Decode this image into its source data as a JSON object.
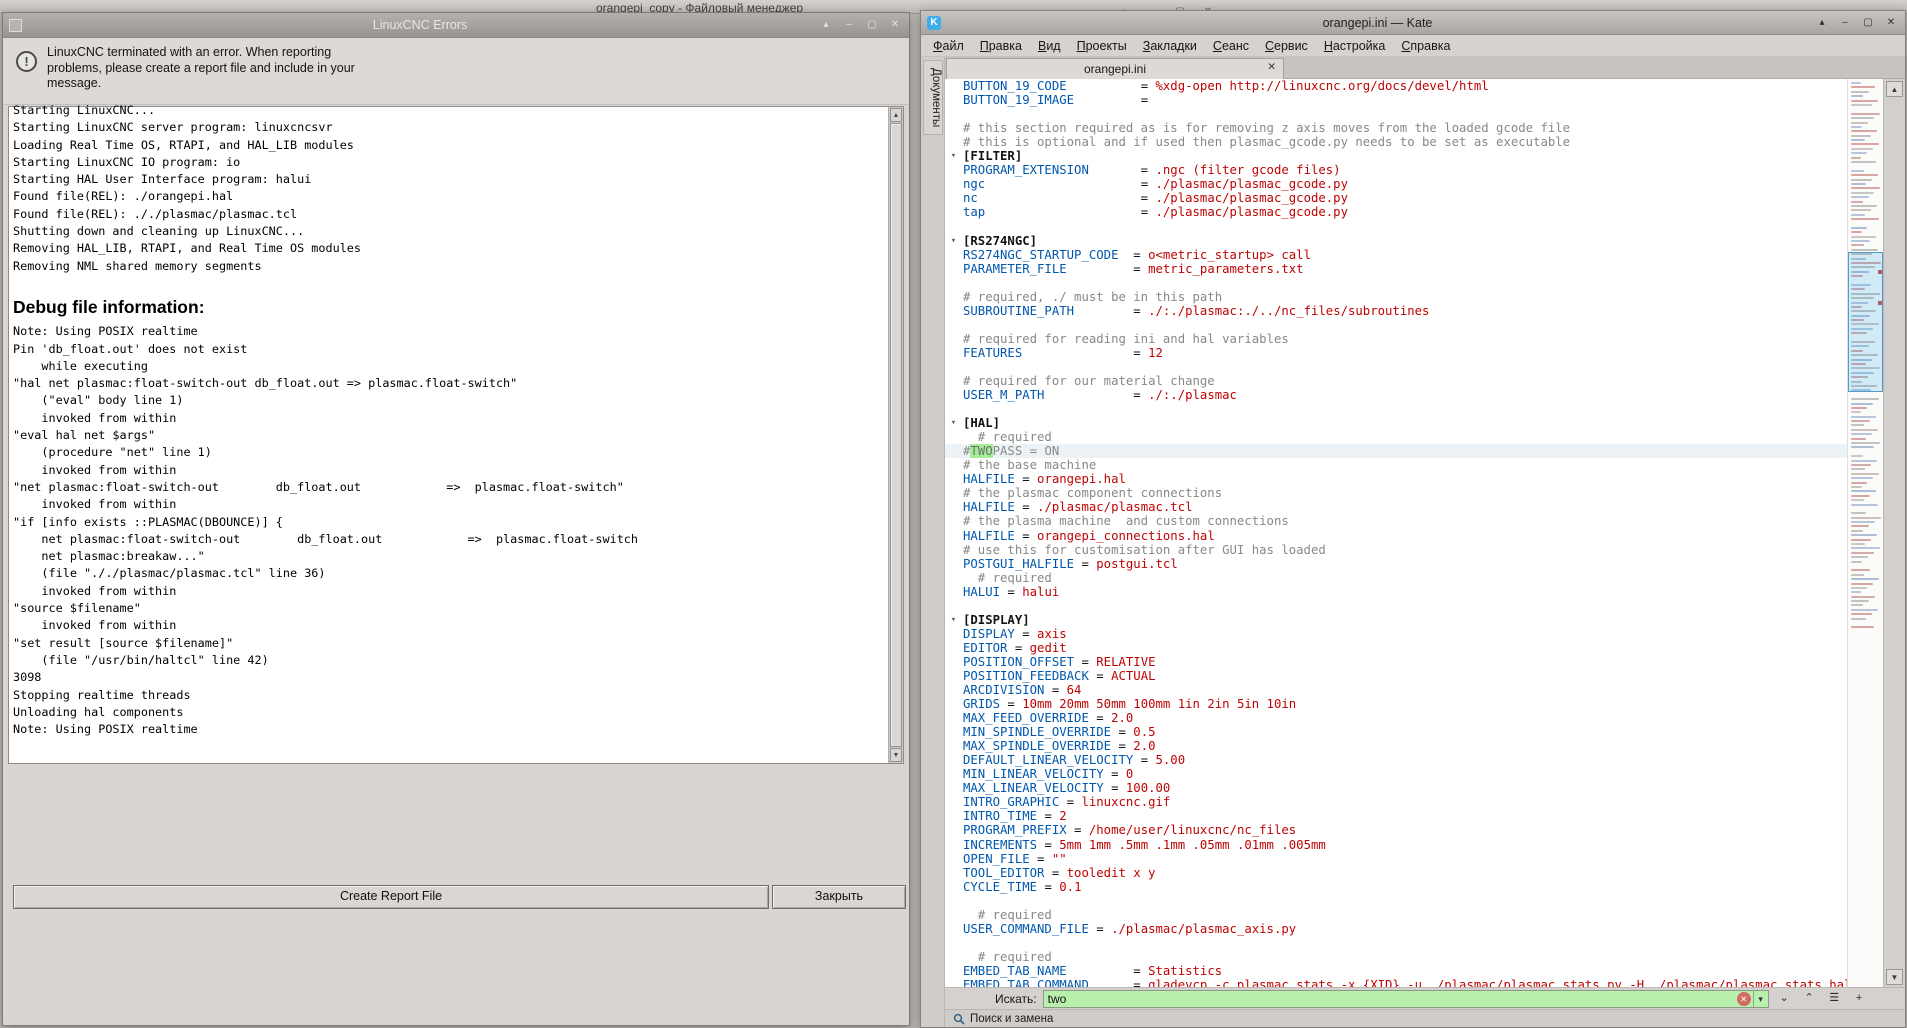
{
  "desktop": {
    "background_window": {
      "title": "orangepi_copy - Файловый менеджер",
      "controls": [
        "▴",
        "–",
        "▢",
        "✕"
      ]
    }
  },
  "errors_window": {
    "title": "LinuxCNC Errors",
    "controls": [
      "▴",
      "–",
      "▢",
      "✕"
    ],
    "info_text": "LinuxCNC terminated with an error.  When reporting\nproblems, please create a report file and include in your\nmessage.",
    "log": {
      "header_index": 11,
      "lines": [
        "Starting LinuxCNC...",
        "Starting LinuxCNC server program: linuxcncsvr",
        "Loading Real Time OS, RTAPI, and HAL_LIB modules",
        "Starting LinuxCNC IO program: io",
        "Starting HAL User Interface program: halui",
        "Found file(REL): ./orangepi.hal",
        "Found file(REL): ././plasmac/plasmac.tcl",
        "Shutting down and cleaning up LinuxCNC...",
        "Removing HAL_LIB, RTAPI, and Real Time OS modules",
        "Removing NML shared memory segments",
        "",
        "Debug file information:",
        "Note: Using POSIX realtime",
        "Pin 'db_float.out' does not exist",
        "    while executing",
        "\"hal net plasmac:float-switch-out db_float.out => plasmac.float-switch\"",
        "    (\"eval\" body line 1)",
        "    invoked from within",
        "\"eval hal net $args\"",
        "    (procedure \"net\" line 1)",
        "    invoked from within",
        "\"net plasmac:float-switch-out        db_float.out            =>  plasmac.float-switch\"",
        "    invoked from within",
        "\"if [info exists ::PLASMAC(DBOUNCE)] {",
        "    net plasmac:float-switch-out        db_float.out            =>  plasmac.float-switch",
        "    net plasmac:breakaw...\"",
        "    (file \"././plasmac/plasmac.tcl\" line 36)",
        "    invoked from within",
        "\"source $filename\"",
        "    invoked from within",
        "\"set result [source $filename]\"",
        "    (file \"/usr/bin/haltcl\" line 42)",
        "3098",
        "Stopping realtime threads",
        "Unloading hal components",
        "Note: Using POSIX realtime"
      ]
    },
    "buttons": {
      "create_report": "Create Report File",
      "close": "Закрыть"
    },
    "scrollbar": {
      "up": "▲",
      "down": "▼"
    }
  },
  "kate_window": {
    "title": "orangepi.ini — Kate",
    "controls": [
      "▴",
      "–",
      "▢",
      "✕"
    ],
    "menu": [
      "Файл",
      "Правка",
      "Вид",
      "Проекты",
      "Закладки",
      "Сеанс",
      "Сервис",
      "Настройка",
      "Справка"
    ],
    "tab_label": "orangepi.ini",
    "tab_close": "✕",
    "side_tab": "Документы",
    "icons": {
      "fold": "▾",
      "up": "▲",
      "down": "▼"
    },
    "current_line_index": 26,
    "fold_lines": [
      5,
      11,
      24,
      38
    ],
    "editor_lines": [
      [
        [
          "k",
          "BUTTON_19_CODE"
        ],
        [
          "p",
          "          = "
        ],
        [
          "v",
          "%xdg-open http://linuxcnc.org/docs/devel/html"
        ]
      ],
      [
        [
          "k",
          "BUTTON_19_IMAGE"
        ],
        [
          "p",
          "         ="
        ]
      ],
      [],
      [
        [
          "c",
          "# this section required as is for removing z axis moves from the loaded gcode file"
        ]
      ],
      [
        [
          "c",
          "# this is optional and if used then plasmac_gcode.py needs to be set as executable"
        ]
      ],
      [
        [
          "s",
          "[FILTER]"
        ]
      ],
      [
        [
          "k",
          "PROGRAM_EXTENSION"
        ],
        [
          "p",
          "       = "
        ],
        [
          "v",
          ".ngc (filter gcode files)"
        ]
      ],
      [
        [
          "k",
          "ngc"
        ],
        [
          "p",
          "                     = "
        ],
        [
          "v",
          "./plasmac/plasmac_gcode.py"
        ]
      ],
      [
        [
          "k",
          "nc"
        ],
        [
          "p",
          "                      = "
        ],
        [
          "v",
          "./plasmac/plasmac_gcode.py"
        ]
      ],
      [
        [
          "k",
          "tap"
        ],
        [
          "p",
          "                     = "
        ],
        [
          "v",
          "./plasmac/plasmac_gcode.py"
        ]
      ],
      [],
      [
        [
          "s",
          "[RS274NGC]"
        ]
      ],
      [
        [
          "k",
          "RS274NGC_STARTUP_CODE"
        ],
        [
          "p",
          "  = "
        ],
        [
          "v",
          "o<metric_startup> call"
        ]
      ],
      [
        [
          "k",
          "PARAMETER_FILE"
        ],
        [
          "p",
          "         = "
        ],
        [
          "v",
          "metric_parameters.txt"
        ]
      ],
      [],
      [
        [
          "c",
          "# required, ./ must be in this path"
        ]
      ],
      [
        [
          "k",
          "SUBROUTINE_PATH"
        ],
        [
          "p",
          "        = "
        ],
        [
          "v",
          "./:./plasmac:./../nc_files/subroutines"
        ]
      ],
      [],
      [
        [
          "c",
          "# required for reading ini and hal variables"
        ]
      ],
      [
        [
          "k",
          "FEATURES"
        ],
        [
          "p",
          "               = "
        ],
        [
          "v",
          "12"
        ]
      ],
      [],
      [
        [
          "c",
          "# required for our material change"
        ]
      ],
      [
        [
          "k",
          "USER_M_PATH"
        ],
        [
          "p",
          "            = "
        ],
        [
          "v",
          "./:./plasmac"
        ]
      ],
      [],
      [
        [
          "s",
          "[HAL]"
        ]
      ],
      [
        [
          "c",
          "  # required"
        ]
      ],
      [
        [
          "c",
          "#"
        ],
        [
          "cm",
          "TWO"
        ],
        [
          "c",
          "PASS = ON"
        ]
      ],
      [
        [
          "c",
          "# the base machine"
        ]
      ],
      [
        [
          "k",
          "HALFILE"
        ],
        [
          "p",
          " = "
        ],
        [
          "v",
          "orangepi.hal"
        ]
      ],
      [
        [
          "c",
          "# the plasmac component connections"
        ]
      ],
      [
        [
          "k",
          "HALFILE"
        ],
        [
          "p",
          " = "
        ],
        [
          "v",
          "./plasmac/plasmac.tcl"
        ]
      ],
      [
        [
          "c",
          "# the plasma machine  and custom connections"
        ]
      ],
      [
        [
          "k",
          "HALFILE"
        ],
        [
          "p",
          " = "
        ],
        [
          "v",
          "orangepi_connections.hal"
        ]
      ],
      [
        [
          "c",
          "# use this for customisation after GUI has loaded"
        ]
      ],
      [
        [
          "k",
          "POSTGUI_HALFILE"
        ],
        [
          "p",
          " = "
        ],
        [
          "v",
          "postgui.tcl"
        ]
      ],
      [
        [
          "c",
          "  # required"
        ]
      ],
      [
        [
          "k",
          "HALUI"
        ],
        [
          "p",
          " = "
        ],
        [
          "v",
          "halui"
        ]
      ],
      [],
      [
        [
          "s",
          "[DISPLAY]"
        ]
      ],
      [
        [
          "k",
          "DISPLAY"
        ],
        [
          "p",
          " = "
        ],
        [
          "v",
          "axis"
        ]
      ],
      [
        [
          "k",
          "EDITOR"
        ],
        [
          "p",
          " = "
        ],
        [
          "v",
          "gedit"
        ]
      ],
      [
        [
          "k",
          "POSITION_OFFSET"
        ],
        [
          "p",
          " = "
        ],
        [
          "v",
          "RELATIVE"
        ]
      ],
      [
        [
          "k",
          "POSITION_FEEDBACK"
        ],
        [
          "p",
          " = "
        ],
        [
          "v",
          "ACTUAL"
        ]
      ],
      [
        [
          "k",
          "ARCDIVISION"
        ],
        [
          "p",
          " = "
        ],
        [
          "v",
          "64"
        ]
      ],
      [
        [
          "k",
          "GRIDS"
        ],
        [
          "p",
          " = "
        ],
        [
          "v",
          "10mm 20mm 50mm 100mm 1in 2in 5in 10in"
        ]
      ],
      [
        [
          "k",
          "MAX_FEED_OVERRIDE"
        ],
        [
          "p",
          " = "
        ],
        [
          "v",
          "2.0"
        ]
      ],
      [
        [
          "k",
          "MIN_SPINDLE_OVERRIDE"
        ],
        [
          "p",
          " = "
        ],
        [
          "v",
          "0.5"
        ]
      ],
      [
        [
          "k",
          "MAX_SPINDLE_OVERRIDE"
        ],
        [
          "p",
          " = "
        ],
        [
          "v",
          "2.0"
        ]
      ],
      [
        [
          "k",
          "DEFAULT_LINEAR_VELOCITY"
        ],
        [
          "p",
          " = "
        ],
        [
          "v",
          "5.00"
        ]
      ],
      [
        [
          "k",
          "MIN_LINEAR_VELOCITY"
        ],
        [
          "p",
          " = "
        ],
        [
          "v",
          "0"
        ]
      ],
      [
        [
          "k",
          "MAX_LINEAR_VELOCITY"
        ],
        [
          "p",
          " = "
        ],
        [
          "v",
          "100.00"
        ]
      ],
      [
        [
          "k",
          "INTRO_GRAPHIC"
        ],
        [
          "p",
          " = "
        ],
        [
          "v",
          "linuxcnc.gif"
        ]
      ],
      [
        [
          "k",
          "INTRO_TIME"
        ],
        [
          "p",
          " = "
        ],
        [
          "v",
          "2"
        ]
      ],
      [
        [
          "k",
          "PROGRAM_PREFIX"
        ],
        [
          "p",
          " = "
        ],
        [
          "v",
          "/home/user/linuxcnc/nc_files"
        ]
      ],
      [
        [
          "k",
          "INCREMENTS"
        ],
        [
          "p",
          " = "
        ],
        [
          "v",
          "5mm 1mm .5mm .1mm .05mm .01mm .005mm"
        ]
      ],
      [
        [
          "k",
          "OPEN_FILE"
        ],
        [
          "p",
          " = "
        ],
        [
          "v",
          "\"\""
        ]
      ],
      [
        [
          "k",
          "TOOL_EDITOR"
        ],
        [
          "p",
          " = "
        ],
        [
          "v",
          "tooledit x y"
        ]
      ],
      [
        [
          "k",
          "CYCLE_TIME"
        ],
        [
          "p",
          " = "
        ],
        [
          "v",
          "0.1"
        ]
      ],
      [],
      [
        [
          "c",
          "  # required"
        ]
      ],
      [
        [
          "k",
          "USER_COMMAND_FILE"
        ],
        [
          "p",
          " = "
        ],
        [
          "v",
          "./plasmac/plasmac_axis.py"
        ]
      ],
      [],
      [
        [
          "c",
          "  # required"
        ]
      ],
      [
        [
          "k",
          "EMBED_TAB_NAME"
        ],
        [
          "p",
          "         = "
        ],
        [
          "v",
          "Statistics"
        ]
      ],
      [
        [
          "k",
          "EMBED_TAB_COMMAND"
        ],
        [
          "p",
          "      = "
        ],
        [
          "v",
          "gladevcp -c plasmac_stats -x {XID} -u ./plasmac/plasmac_stats.py -H ./plasmac/plasmac_stats.hal"
        ]
      ]
    ],
    "search": {
      "label": "Искать:",
      "value": "two",
      "icons": {
        "clear": "✕",
        "dropdown": "▾",
        "next": "⌄",
        "prev": "⌃",
        "options": "☰",
        "power": "+"
      },
      "toolview": "Поиск и замена"
    }
  },
  "colors": {
    "key": "#0057ae",
    "value": "#bf0303",
    "comment": "#898887",
    "match_bg": "#a3ee94",
    "accent": "#3daee9",
    "search_field_bg": "#b9f0ae"
  }
}
